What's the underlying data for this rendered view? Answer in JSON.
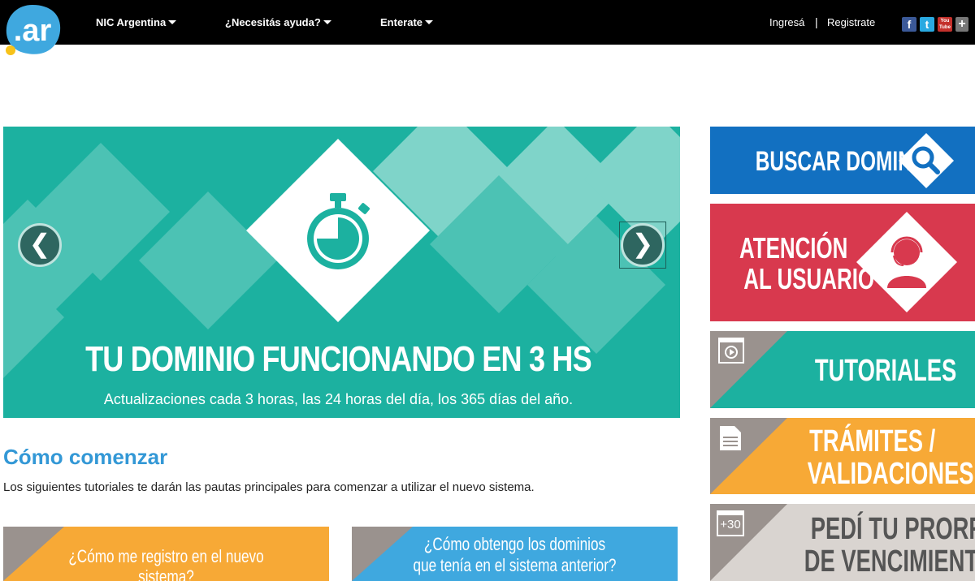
{
  "header": {
    "logo_text": ".ar",
    "nav": [
      {
        "label": "NIC Argentina"
      },
      {
        "label": "¿Necesitás ayuda?"
      },
      {
        "label": "Enterate"
      }
    ],
    "login": "Ingresá",
    "separator": "|",
    "register": "Registrate",
    "social": [
      {
        "name": "facebook-icon",
        "glyph": "f",
        "color": "#3b5998"
      },
      {
        "name": "twitter-icon",
        "glyph": "t",
        "color": "#29a9e1"
      },
      {
        "name": "youtube-icon",
        "glyph": "You Tube",
        "color": "#c4302b"
      },
      {
        "name": "plus-icon",
        "glyph": "+",
        "color": "#777777"
      }
    ]
  },
  "hero": {
    "title": "TU DOMINIO FUNCIONANDO EN 3 HS",
    "subtitle": "Actualizaciones cada 3 horas, las 24 horas del día, los 365 días del año.",
    "prev": "❮",
    "next": "❯",
    "colors": {
      "bg": "#1cb1a0",
      "light": "#7fd4c9",
      "mid": "#4cc2b4"
    }
  },
  "section": {
    "title": "Cómo comenzar",
    "text": "Los siguientes tutoriales te darán las pautas principales para comenzar a utilizar el nuevo sistema."
  },
  "tutorials": [
    {
      "label": "¿Cómo me registro en el nuevo sistema?",
      "color": "#f7a936"
    },
    {
      "label_line1": "¿Cómo obtengo los dominios",
      "label_line2": "que tenía en el sistema anterior?",
      "color": "#3fa8df"
    }
  ],
  "sidebar": {
    "buscar": {
      "label": "BUSCAR DOMINIOS",
      "color": "#1270c1"
    },
    "atencion": {
      "line1": "ATENCIÓN",
      "line2": "AL USUARIO",
      "color": "#d8394e"
    },
    "tutoriales": {
      "label": "TUTORIALES",
      "color": "#1cb1a0"
    },
    "tramites": {
      "line1": "TRÁMITES /",
      "line2": "VALIDACIONES",
      "color": "#f7a936"
    },
    "prorroga": {
      "line1": "PEDÍ TU PRORROGA",
      "line2": "DE VENCIMIENTO",
      "badge": "+30",
      "color": "#d9d4d0"
    }
  }
}
